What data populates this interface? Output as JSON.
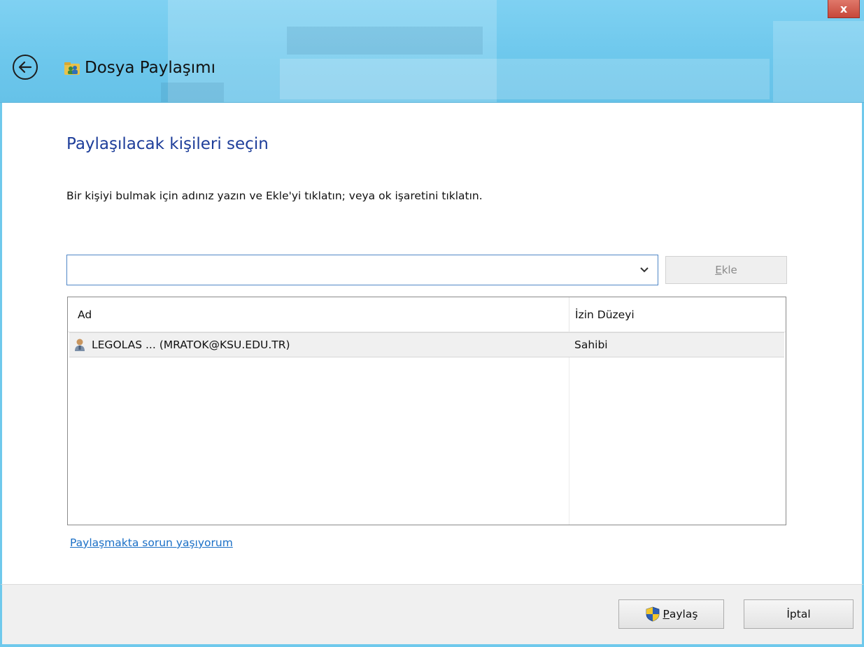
{
  "window": {
    "title": "Dosya Paylaşımı",
    "close_label": "x"
  },
  "main": {
    "heading": "Paylaşılacak kişileri seçin",
    "instruction": "Bir kişiyi bulmak için adınız yazın ve Ekle'yi tıklatın; veya ok işaretini tıklatın.",
    "person_input": {
      "value": "",
      "placeholder": ""
    },
    "add_button": {
      "mnemonic": "E",
      "rest": "kle"
    },
    "list": {
      "columns": [
        "Ad",
        "İzin Düzeyi"
      ],
      "rows": [
        {
          "name": "LEGOLAS ... (MRATOK@KSU.EDU.TR)",
          "permission": "Sahibi"
        }
      ]
    },
    "help_link": "Paylaşmakta sorun yaşıyorum"
  },
  "footer": {
    "share_button": {
      "mnemonic": "P",
      "rest": "aylaş"
    },
    "cancel_button": "İptal"
  },
  "icons": {
    "back": "back-arrow-icon",
    "app": "homegroup-share-icon",
    "user": "user-icon",
    "shield": "uac-shield-icon",
    "dropdown": "chevron-down-icon"
  },
  "colors": {
    "titlebar": "#6fc9ec",
    "heading": "#1e3e9a",
    "link": "#1a6fc6",
    "close": "#c7473a"
  }
}
